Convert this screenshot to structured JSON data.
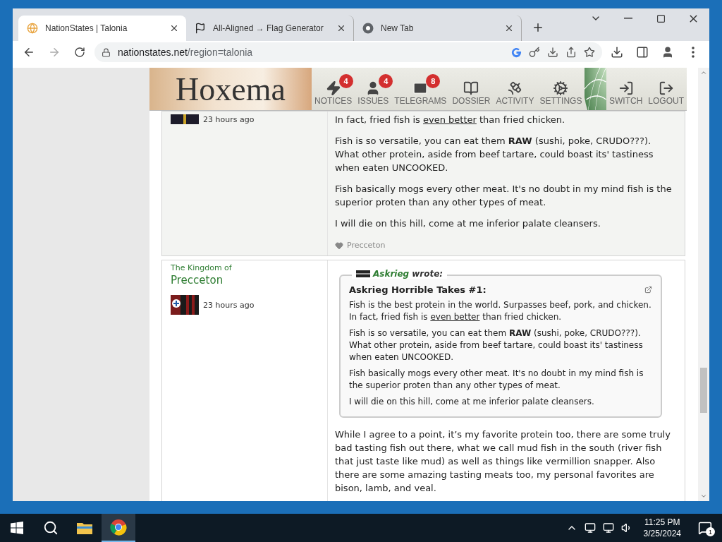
{
  "tabs": [
    {
      "title": "NationStates | Talonia",
      "selected": true
    },
    {
      "title": "All-Aligned → Flag Generator",
      "selected": false
    },
    {
      "title": "New Tab",
      "selected": false
    }
  ],
  "address": {
    "host": "nationstates.net",
    "path": "/region=talonia"
  },
  "banner": {
    "nation": "Hoxema",
    "nav": [
      {
        "label": "NOTICES",
        "badge": "4"
      },
      {
        "label": "ISSUES",
        "badge": "4"
      },
      {
        "label": "TELEGRAMS",
        "badge": "8"
      },
      {
        "label": "DOSSIER"
      },
      {
        "label": "ACTIVITY"
      },
      {
        "label": "SETTINGS"
      }
    ],
    "account": [
      {
        "label": "SWITCH"
      },
      {
        "label": "LOGOUT"
      }
    ]
  },
  "posts": [
    {
      "time": "23 hours ago",
      "paragraphs": [
        [
          {
            "kind": "plain",
            "text": "In fact, fried fish is "
          },
          {
            "kind": "underline",
            "text": "even better"
          },
          {
            "kind": "plain",
            "text": " than fried chicken."
          }
        ],
        [
          {
            "kind": "plain",
            "text": "Fish is so versatile, you can eat them "
          },
          {
            "kind": "bold",
            "text": "RAW"
          },
          {
            "kind": "plain",
            "text": " (sushi, poke, CRUDO???). What other protein, aside from beef tartare, could boast its' tastiness when eaten UNCOOKED."
          }
        ],
        [
          {
            "kind": "plain",
            "text": "Fish basically mogs every other meat. It's no doubt in my mind fish is the superior proten than any other types of meat."
          }
        ],
        [
          {
            "kind": "plain",
            "text": "I will die on this hill, come at me inferior palate cleansers."
          }
        ]
      ],
      "likes": "Precceton"
    },
    {
      "pretitle": "The Kingdom of",
      "nation": "Precceton",
      "time": "23 hours ago",
      "quote": {
        "author": "Askrieg",
        "wrote": "wrote:",
        "title": "Askrieg Horrible Takes #1:",
        "paragraphs": [
          [
            {
              "kind": "plain",
              "text": "Fish is the best protein in the world. Surpasses beef, pork, and chicken. In fact, fried fish is "
            },
            {
              "kind": "underline",
              "text": "even better"
            },
            {
              "kind": "plain",
              "text": " than fried chicken."
            }
          ],
          [
            {
              "kind": "plain",
              "text": "Fish is so versatile, you can eat them "
            },
            {
              "kind": "bold",
              "text": "RAW"
            },
            {
              "kind": "plain",
              "text": " (sushi, poke, CRUDO???). What other protein, aside from beef tartare, could boast its' tastiness when eaten UNCOOKED."
            }
          ],
          [
            {
              "kind": "plain",
              "text": "Fish basically mogs every other meat. It's no doubt in my mind fish is the superior proten than any other types of meat."
            }
          ],
          [
            {
              "kind": "plain",
              "text": "I will die on this hill, come at me inferior palate cleansers."
            }
          ]
        ]
      },
      "paragraphs": [
        [
          {
            "kind": "plain",
            "text": "While I agree to a point, it’s my favorite protein too, there are some truly bad tasting fish out there, what we call mud fish in the south (river fish that just taste like mud) as well as things like vermillion snapper. Also there are some amazing tasting meats too, my personal favorites are bison, lamb, and veal."
          }
        ]
      ]
    }
  ],
  "taskbar": {
    "time": "11:25 PM",
    "date": "3/25/2024",
    "notifications": "1"
  }
}
